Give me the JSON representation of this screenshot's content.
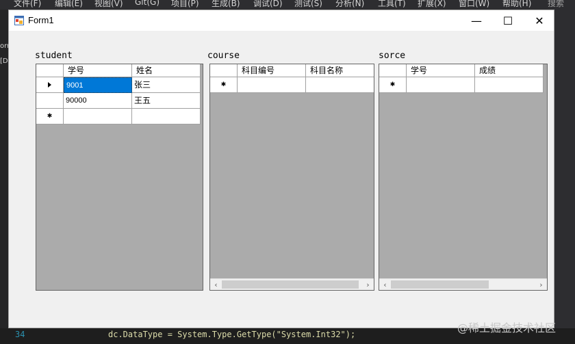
{
  "ide": {
    "menu": [
      "文件(F)",
      "编辑(E)",
      "视图(V)",
      "Git(G)",
      "项目(P)",
      "生成(B)",
      "调试(D)",
      "测试(S)",
      "分析(N)",
      "工具(T)",
      "扩展(X)",
      "窗口(W)",
      "帮助(H)"
    ],
    "search": "搜索 (C",
    "left_fragments": [
      "orr",
      "[D"
    ],
    "line_number": "34",
    "code_line": "dc.DataType = System.Type.GetType(\"System.Int32\");",
    "watermark": "@稀土掘金技术社区"
  },
  "window": {
    "title": "Form1",
    "minimize_glyph": "—",
    "maximize_glyph": "☐",
    "close_glyph": "✕"
  },
  "grids": {
    "student": {
      "label": "student",
      "columns": [
        "学号",
        "姓名"
      ],
      "rows": [
        [
          "9001",
          "张三"
        ],
        [
          "90000",
          "王五"
        ]
      ]
    },
    "course": {
      "label": "course",
      "columns": [
        "科目编号",
        "科目名称"
      ],
      "rows": []
    },
    "sorce": {
      "label": "sorce",
      "columns": [
        "学号",
        "成绩"
      ],
      "rows": []
    }
  },
  "icons": {
    "current_row": "row-indicator-icon",
    "new_row": "new-row-icon",
    "scroll_left": "‹",
    "scroll_right": "›",
    "new_row_glyph": "✱"
  }
}
